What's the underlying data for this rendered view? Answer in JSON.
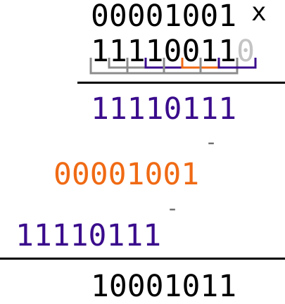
{
  "multiplicand": "00001001",
  "multiply_sign": "x",
  "multiplier_digits": "11110011",
  "appended_bit": "0",
  "partial_1": "11110111",
  "minus_1": "-",
  "partial_2": "00001001",
  "minus_2": "-",
  "partial_3": "11110111",
  "result": "10001011",
  "colors": {
    "text": "#000000",
    "purple": "#3a0c8c",
    "orange": "#f06a14",
    "gray": "#8c8c8c",
    "light_gray": "#c4c4c4",
    "op_gray": "#707070"
  },
  "bit_pairs": [
    {
      "pair": "11",
      "action": "shift",
      "color": "gray"
    },
    {
      "pair": "11",
      "action": "shift",
      "color": "gray"
    },
    {
      "pair": "11",
      "action": "shift",
      "color": "gray"
    },
    {
      "pair": "10",
      "action": "subtract",
      "color": "purple"
    },
    {
      "pair": "00",
      "action": "shift",
      "color": "gray"
    },
    {
      "pair": "01",
      "action": "add",
      "color": "orange"
    },
    {
      "pair": "11",
      "action": "shift",
      "color": "gray"
    },
    {
      "pair": "10",
      "action": "subtract",
      "color": "purple"
    }
  ]
}
